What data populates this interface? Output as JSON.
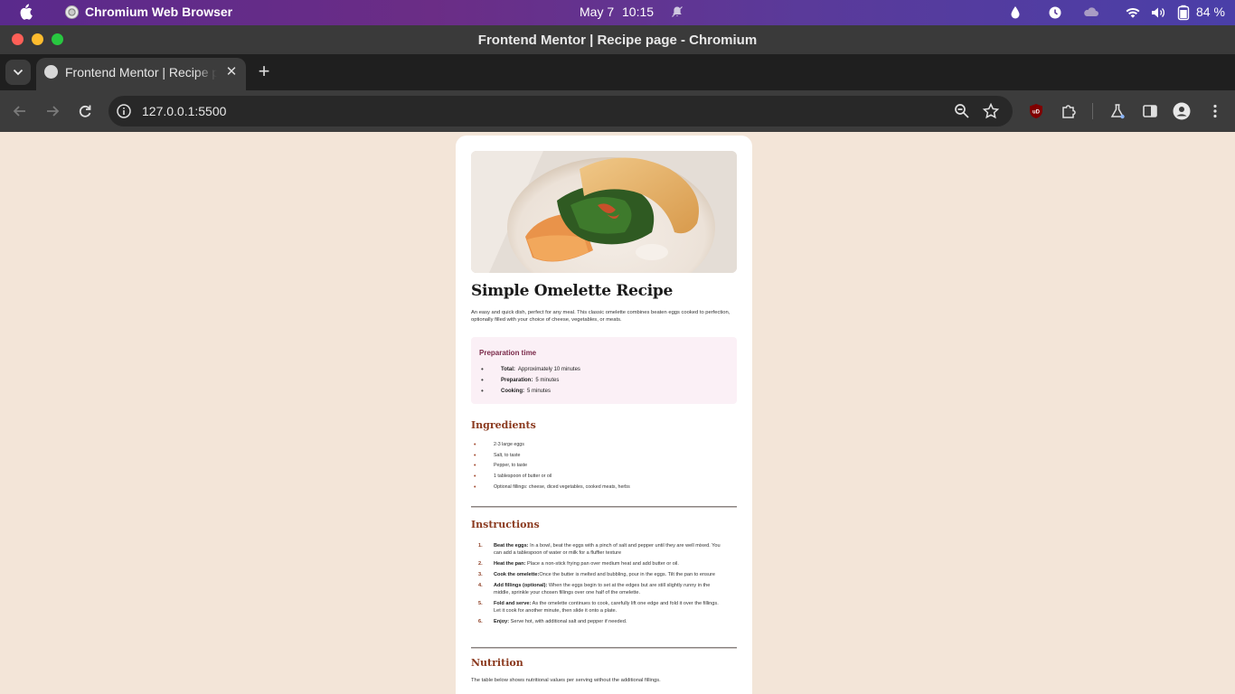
{
  "menubar": {
    "app_name": "Chromium Web Browser",
    "date": "May 7",
    "time": "10:15",
    "battery": "84 %",
    "icons": [
      "apple-icon",
      "drop-icon",
      "clock-icon",
      "cloud-icon",
      "wifi-icon",
      "volume-icon",
      "battery-icon"
    ]
  },
  "window": {
    "title": "Frontend Mentor | Recipe page - Chromium"
  },
  "tabs": [
    {
      "title": "Frontend Mentor | Recipe page"
    }
  ],
  "toolbar": {
    "url": "127.0.0.1:5500"
  },
  "page": {
    "title": "Simple Omelette Recipe",
    "intro": "An easy and quick dish, perfect for any meal. This classic omelette combines beaten eggs cooked to perfection, optionally filled with your choice of cheese, vegetables, or meats.",
    "prep": {
      "title": "Preparation time",
      "items": [
        {
          "label": "Total:",
          "value": "Approximately  10  minutes"
        },
        {
          "label": "Preparation:",
          "value": "5  minutes"
        },
        {
          "label": "Cooking:",
          "value": "5  minutes"
        }
      ]
    },
    "ingredients": {
      "title": "Ingredients",
      "items": [
        "2-3 large eggs",
        "Salt, to taste",
        "Pepper, to taste",
        "1 tablespoon of butter or oil",
        "Optional fillings: cheese, diced vegetables, cooked meats, herbs"
      ]
    },
    "instructions": {
      "title": "Instructions",
      "items": [
        {
          "num": "1.",
          "label": "Beat the eggs:",
          "text": " In a bowl, beat the eggs with a pinch of salt and pepper until they are well mixed. You can add a tablespoon of water or milk for a fluffier texture"
        },
        {
          "num": "2.",
          "label": "Heat the pan:",
          "text": " Place a non-stick frying pan over medium heat and add butter or oil."
        },
        {
          "num": "3.",
          "label": "Cook the omelette:",
          "text": "Once the butter is melted and bubbling, pour in the eggs. Tilt the pan to ensure"
        },
        {
          "num": "4.",
          "label": "Add fillings (optional):",
          "text": " When the eggs begin to set at the edges but are still slightly runny in the middle, sprinkle your chosen fillings over one half of the omelette."
        },
        {
          "num": "5.",
          "label": "Fold and serve:",
          "text": " As the omelette continues to cook, carefully lift one edge and fold it over the fillings. Let it cook for another minute, then slide it onto a plate."
        },
        {
          "num": "6.",
          "label": "Enjoy:",
          "text": " Serve hot, with additional salt and pepper if needed."
        }
      ]
    },
    "nutrition": {
      "title": "Nutrition",
      "text": "The table below shows nutritional values per serving without the additional fillings."
    }
  }
}
